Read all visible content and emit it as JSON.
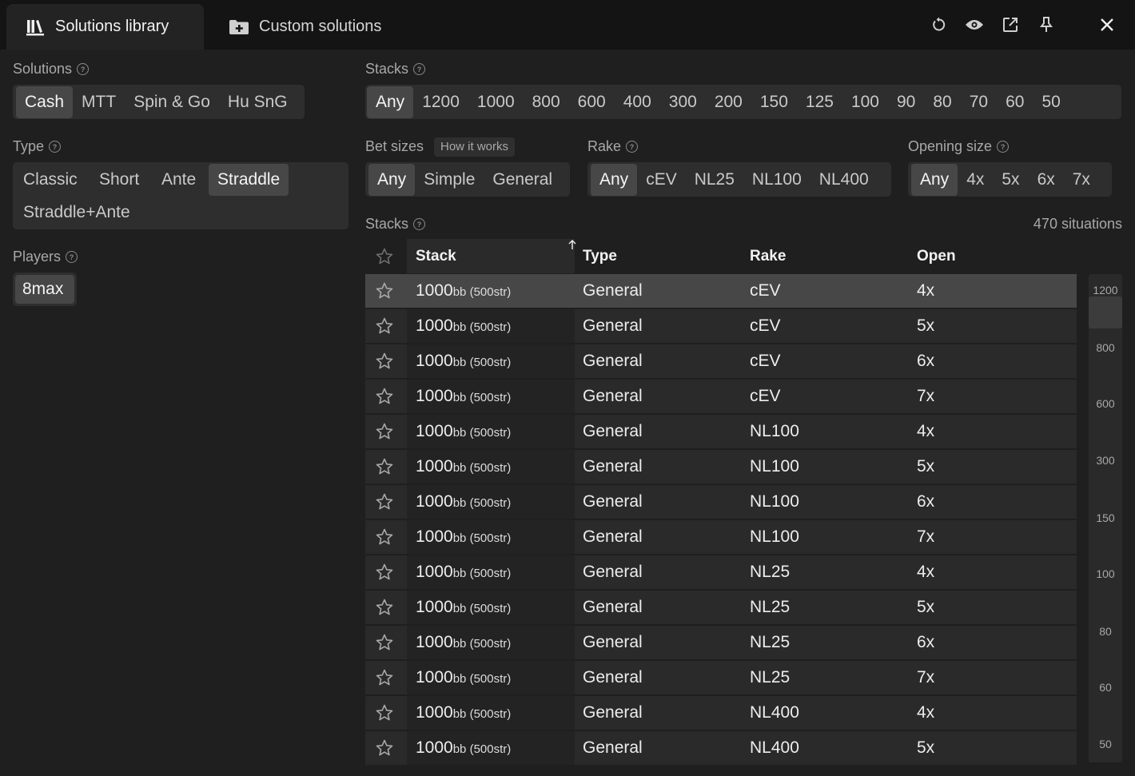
{
  "tabs": {
    "library": "Solutions library",
    "custom": "Custom solutions"
  },
  "header_icons": [
    "refresh-icon",
    "eye-icon",
    "external-link-icon",
    "pin-icon",
    "close-icon"
  ],
  "solutions": {
    "label": "Solutions",
    "options": [
      "Cash",
      "MTT",
      "Spin & Go",
      "Hu SnG"
    ],
    "selected": "Cash"
  },
  "type": {
    "label": "Type",
    "options": [
      "Classic",
      "Short",
      "Ante",
      "Straddle",
      "Straddle+Ante"
    ],
    "selected": "Straddle"
  },
  "players": {
    "label": "Players",
    "options": [
      "8max"
    ],
    "selected": "8max"
  },
  "stacks_filter": {
    "label": "Stacks",
    "options": [
      "Any",
      "1200",
      "1000",
      "800",
      "600",
      "400",
      "300",
      "200",
      "150",
      "125",
      "100",
      "90",
      "80",
      "70",
      "60",
      "50"
    ],
    "selected": "Any"
  },
  "bet_sizes": {
    "label": "Bet sizes",
    "how": "How it works",
    "options": [
      "Any",
      "Simple",
      "General"
    ],
    "selected": "Any"
  },
  "rake": {
    "label": "Rake",
    "options": [
      "Any",
      "cEV",
      "NL25",
      "NL100",
      "NL400"
    ],
    "selected": "Any"
  },
  "opening": {
    "label": "Opening size",
    "options": [
      "Any",
      "4x",
      "5x",
      "6x",
      "7x"
    ],
    "selected": "Any"
  },
  "table": {
    "label": "Stacks",
    "count": "470 situations",
    "columns": {
      "stack": "Stack",
      "type": "Type",
      "rake": "Rake",
      "open": "Open"
    },
    "rows": [
      {
        "stack": "1000",
        "unit": "bb",
        "sub": "(500str)",
        "type": "General",
        "rake": "cEV",
        "open": "4x"
      },
      {
        "stack": "1000",
        "unit": "bb",
        "sub": "(500str)",
        "type": "General",
        "rake": "cEV",
        "open": "5x"
      },
      {
        "stack": "1000",
        "unit": "bb",
        "sub": "(500str)",
        "type": "General",
        "rake": "cEV",
        "open": "6x"
      },
      {
        "stack": "1000",
        "unit": "bb",
        "sub": "(500str)",
        "type": "General",
        "rake": "cEV",
        "open": "7x"
      },
      {
        "stack": "1000",
        "unit": "bb",
        "sub": "(500str)",
        "type": "General",
        "rake": "NL100",
        "open": "4x"
      },
      {
        "stack": "1000",
        "unit": "bb",
        "sub": "(500str)",
        "type": "General",
        "rake": "NL100",
        "open": "5x"
      },
      {
        "stack": "1000",
        "unit": "bb",
        "sub": "(500str)",
        "type": "General",
        "rake": "NL100",
        "open": "6x"
      },
      {
        "stack": "1000",
        "unit": "bb",
        "sub": "(500str)",
        "type": "General",
        "rake": "NL100",
        "open": "7x"
      },
      {
        "stack": "1000",
        "unit": "bb",
        "sub": "(500str)",
        "type": "General",
        "rake": "NL25",
        "open": "4x"
      },
      {
        "stack": "1000",
        "unit": "bb",
        "sub": "(500str)",
        "type": "General",
        "rake": "NL25",
        "open": "5x"
      },
      {
        "stack": "1000",
        "unit": "bb",
        "sub": "(500str)",
        "type": "General",
        "rake": "NL25",
        "open": "6x"
      },
      {
        "stack": "1000",
        "unit": "bb",
        "sub": "(500str)",
        "type": "General",
        "rake": "NL25",
        "open": "7x"
      },
      {
        "stack": "1000",
        "unit": "bb",
        "sub": "(500str)",
        "type": "General",
        "rake": "NL400",
        "open": "4x"
      },
      {
        "stack": "1000",
        "unit": "bb",
        "sub": "(500str)",
        "type": "General",
        "rake": "NL400",
        "open": "5x"
      }
    ]
  },
  "scrollbar_ticks": [
    "1200",
    "800",
    "600",
    "300",
    "150",
    "100",
    "80",
    "60",
    "50"
  ]
}
